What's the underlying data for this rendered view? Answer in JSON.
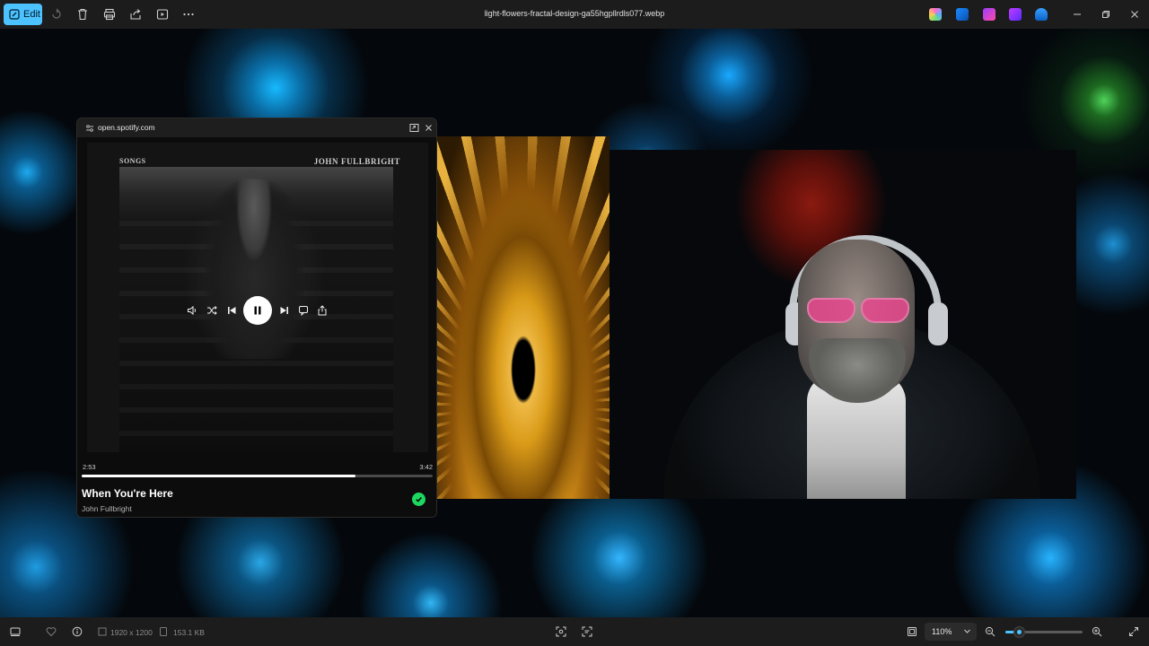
{
  "toolbar": {
    "edit_label": "Edit",
    "filename": "light-flowers-fractal-design-ga55hgpllrdls077.webp",
    "icons": [
      "edit-icon",
      "rotate-icon",
      "delete-icon",
      "print-icon",
      "share-icon",
      "slideshow-icon",
      "more-icon"
    ],
    "app_icons": [
      "copilot-icon",
      "photos-app-icon",
      "clipchamp-icon",
      "designer-icon",
      "onedrive-icon"
    ],
    "window_controls": [
      "minimize-icon",
      "restore-icon",
      "close-icon"
    ]
  },
  "spotify": {
    "url": "open.spotify.com",
    "album_songs": "SONGS",
    "album_artist": "JOHN FULLBRIGHT",
    "time_current": "2:53",
    "time_total": "3:42",
    "progress": 0.78,
    "title": "When You're Here",
    "artist": "John Fullbright",
    "accent": "#1ed760"
  },
  "statusbar": {
    "dimensions": "1920 x 1200",
    "file_size": "153.1 KB",
    "zoom": "110%",
    "zoom_fraction": 0.18,
    "accent": "#4cc2ff"
  }
}
